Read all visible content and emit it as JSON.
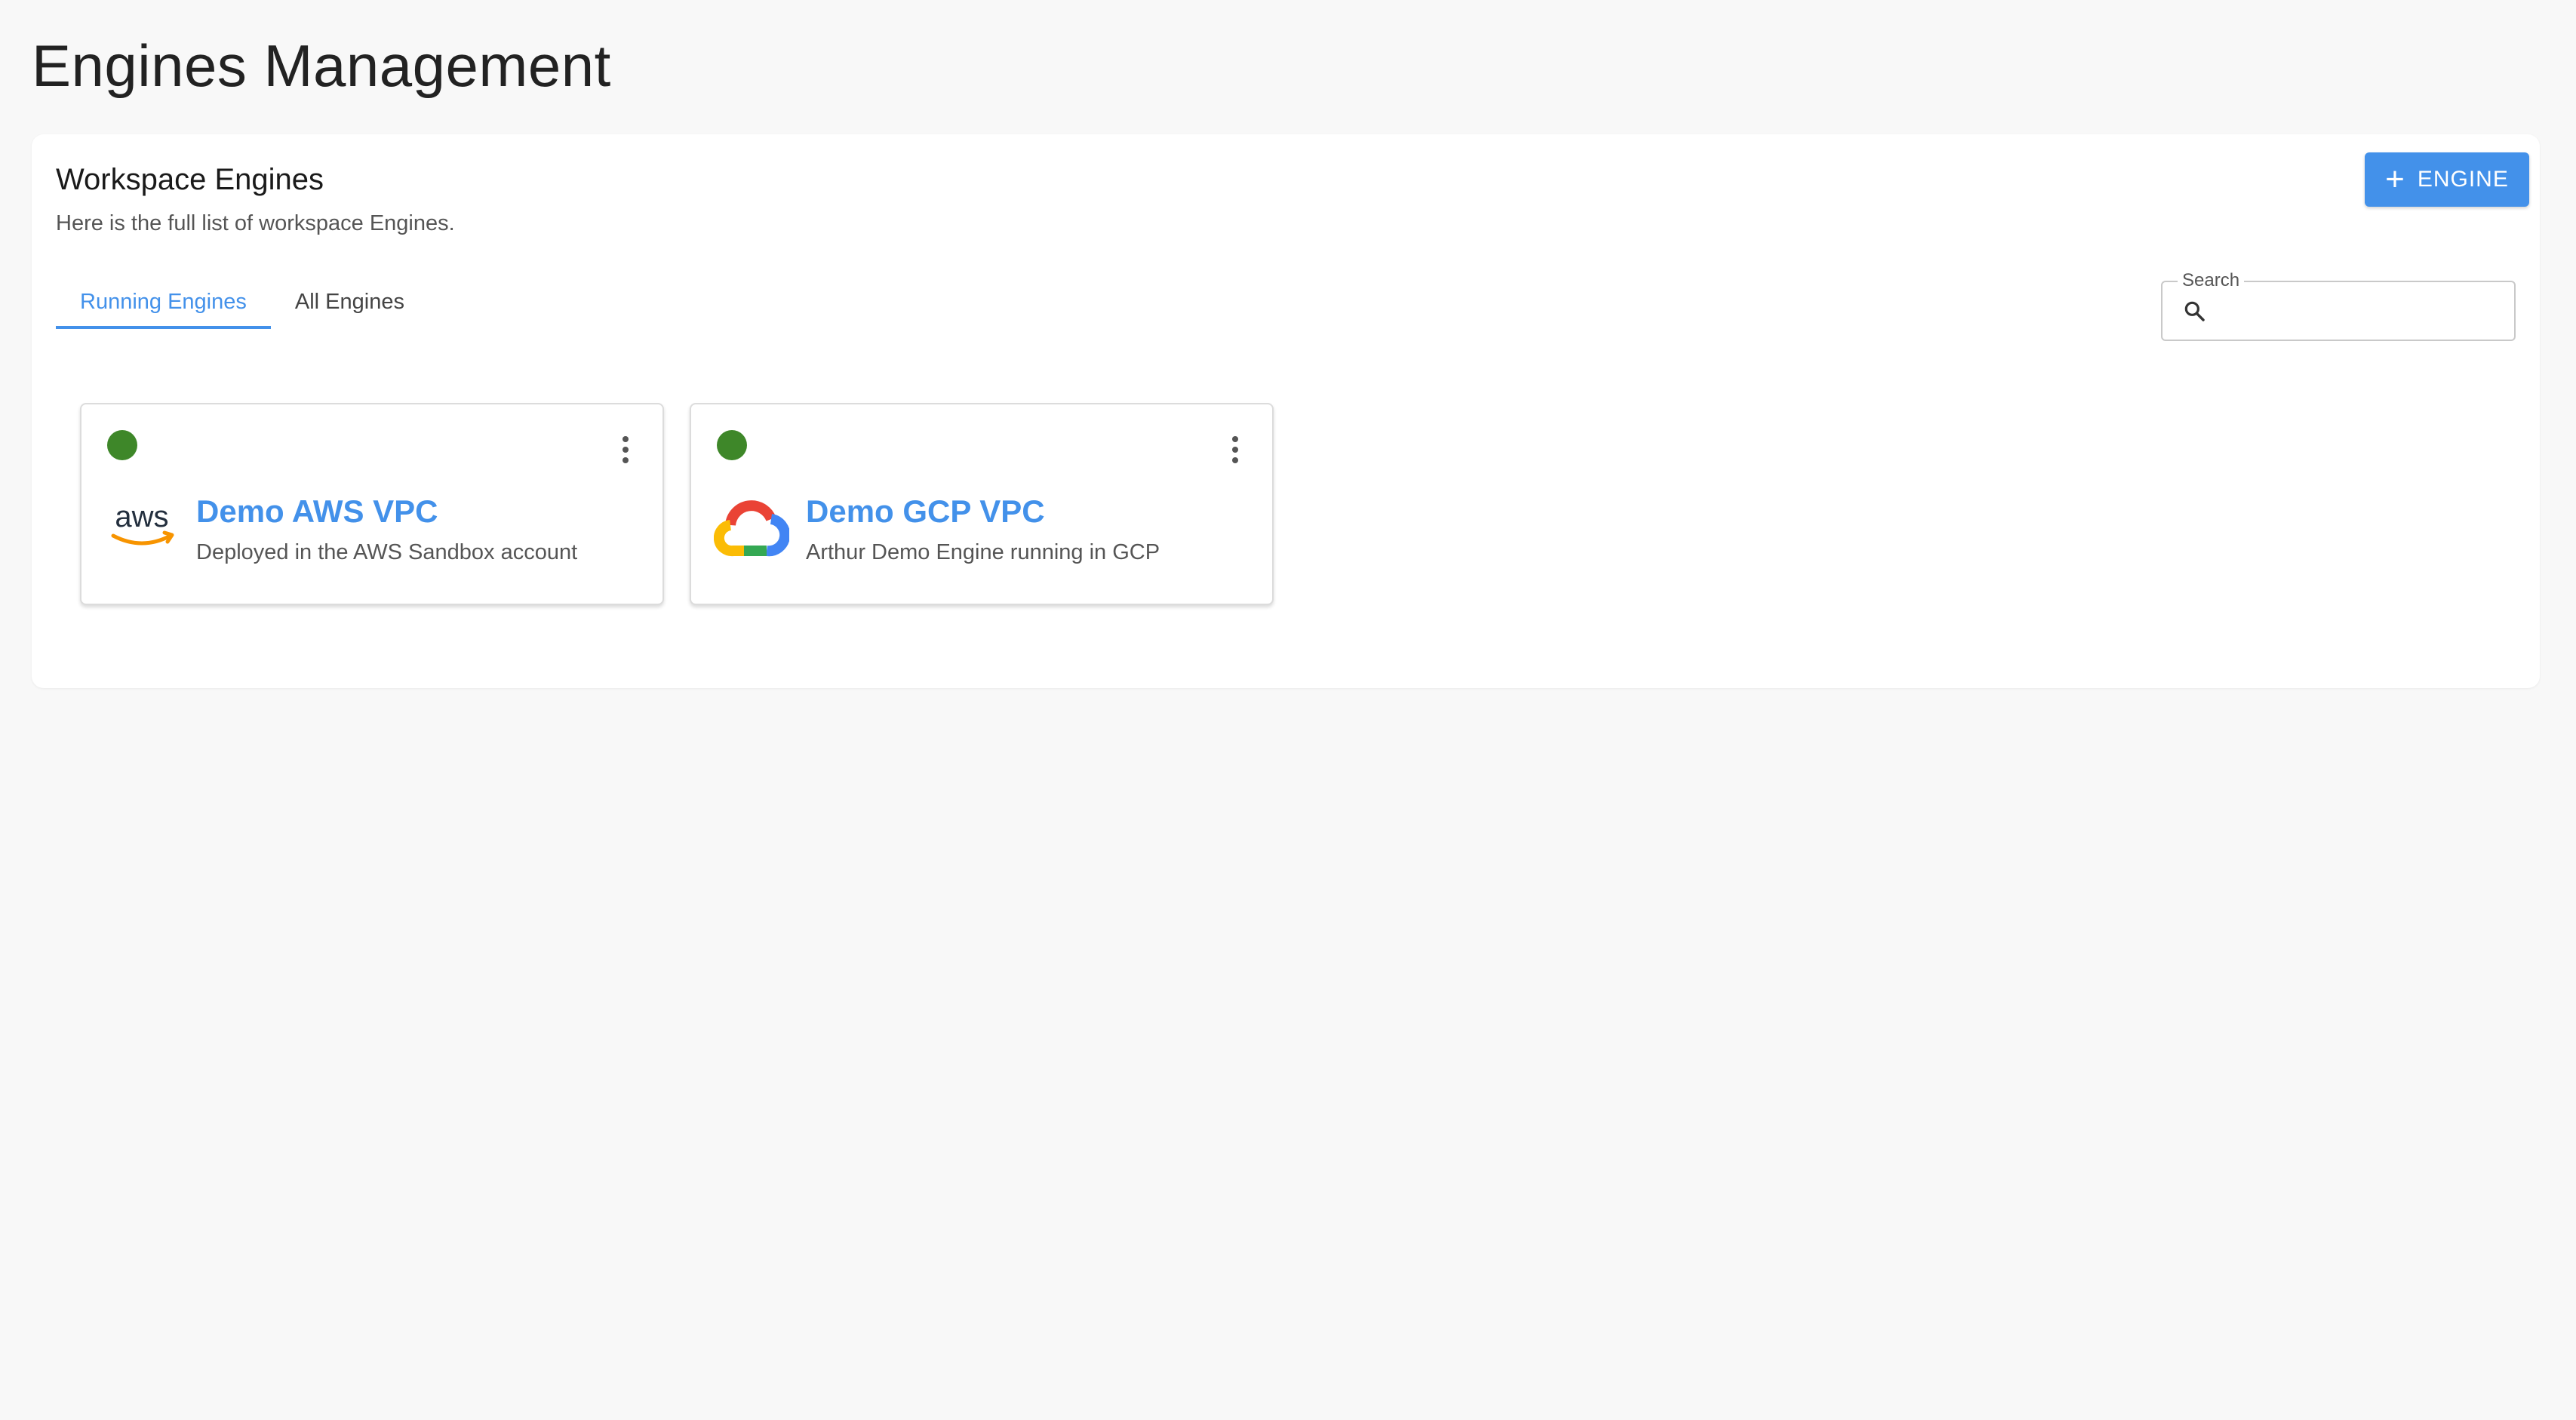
{
  "page": {
    "title": "Engines Management"
  },
  "panel": {
    "title": "Workspace Engines",
    "subtitle": "Here is the full list of workspace Engines.",
    "add_button_label": "ENGINE"
  },
  "tabs": [
    {
      "label": "Running Engines",
      "active": true
    },
    {
      "label": "All Engines",
      "active": false
    }
  ],
  "search": {
    "label": "Search",
    "value": "",
    "placeholder": ""
  },
  "engines": [
    {
      "name": "Demo AWS VPC",
      "description": "Deployed in the AWS Sandbox account",
      "provider_icon": "aws-logo-icon",
      "status": "running",
      "status_color": "#3e8729"
    },
    {
      "name": "Demo GCP VPC",
      "description": "Arthur Demo Engine running in GCP",
      "provider_icon": "google-cloud-logo-icon",
      "status": "running",
      "status_color": "#3e8729"
    }
  ],
  "colors": {
    "accent": "#4391ea",
    "status_running": "#3e8729",
    "background": "#f8f8f8"
  }
}
